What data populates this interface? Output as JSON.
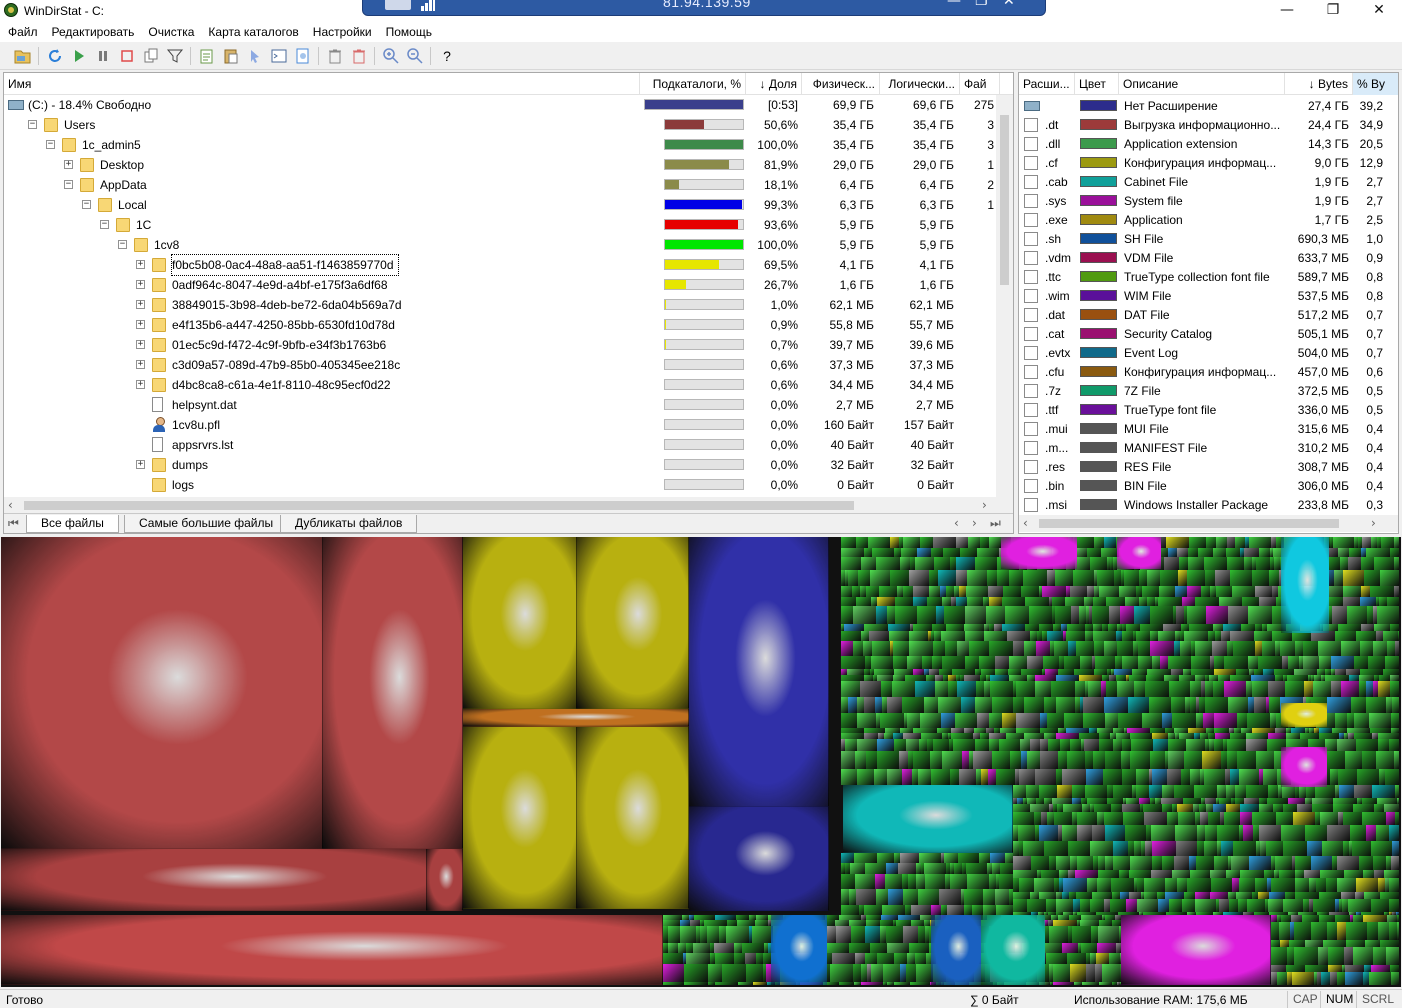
{
  "window": {
    "title": "WinDirStat - C:",
    "remote_ip": "81.94.139.59",
    "min_glyph": "—",
    "max_glyph": "❐",
    "close_glyph": "✕",
    "rdp_min_glyph": "—",
    "rdp_max_glyph": "❐",
    "rdp_close_glyph": "✕"
  },
  "menu": [
    "Файл",
    "Редактировать",
    "Очистка",
    "Карта каталогов",
    "Настройки",
    "Помощь"
  ],
  "toolbar": {
    "icons": [
      "open-icon",
      "refresh-icon",
      "play-icon",
      "pause-icon",
      "stop-icon",
      "copy-path-icon",
      "filter-icon",
      "explorer-icon",
      "paste-icon",
      "select-icon",
      "cmd-icon",
      "properties-icon",
      "delete-recycle-icon",
      "delete-icon",
      "zoom-in-icon",
      "zoom-out-icon",
      "help-icon"
    ],
    "help_label": "?"
  },
  "dir_list": {
    "headers": [
      "Имя",
      "Подкаталоги, %",
      "↓ Доля",
      "Физическ...",
      "Логически...",
      "Фай"
    ],
    "rows": [
      {
        "name": "(C:) - 18.4% Свободно",
        "pct": "[0:53]",
        "phys": "69,9 ГБ",
        "log": "69,6 ГБ",
        "files": "275",
        "bar": 1.0,
        "color": "#3a3f8c",
        "icon": "drive-icon"
      },
      {
        "name": "Users",
        "pct": "50,6%",
        "phys": "35,4 ГБ",
        "log": "35,4 ГБ",
        "files": "3",
        "bar": 0.506,
        "color": "#8b3a3a",
        "icon": "folder-icon"
      },
      {
        "name": "1c_admin5",
        "pct": "100,0%",
        "phys": "35,4 ГБ",
        "log": "35,4 ГБ",
        "files": "3",
        "bar": 1.0,
        "color": "#3d8a4a",
        "icon": "folder-icon"
      },
      {
        "name": "Desktop",
        "pct": "81,9%",
        "phys": "29,0 ГБ",
        "log": "29,0 ГБ",
        "files": "1",
        "bar": 0.819,
        "color": "#8b8b4a",
        "icon": "folder-icon"
      },
      {
        "name": "AppData",
        "pct": "18,1%",
        "phys": "6,4 ГБ",
        "log": "6,4 ГБ",
        "files": "2",
        "bar": 0.181,
        "color": "#8b8b4a",
        "icon": "folder-icon"
      },
      {
        "name": "Local",
        "pct": "99,3%",
        "phys": "6,3 ГБ",
        "log": "6,3 ГБ",
        "files": "1",
        "bar": 0.993,
        "color": "#0000e6",
        "icon": "folder-icon"
      },
      {
        "name": "1C",
        "pct": "93,6%",
        "phys": "5,9 ГБ",
        "log": "5,9 ГБ",
        "files": "",
        "bar": 0.936,
        "color": "#e60000",
        "icon": "folder-icon"
      },
      {
        "name": "1cv8",
        "pct": "100,0%",
        "phys": "5,9 ГБ",
        "log": "5,9 ГБ",
        "files": "",
        "bar": 1.0,
        "color": "#00e600",
        "icon": "folder-icon"
      },
      {
        "name": "f0bc5b08-0ac4-48a8-aa51-f1463859770d",
        "pct": "69,5%",
        "phys": "4,1 ГБ",
        "log": "4,1 ГБ",
        "files": "",
        "bar": 0.695,
        "color": "#e6e600",
        "icon": "folder-icon"
      },
      {
        "name": "0adf964c-8047-4e9d-a4bf-e175f3a6df68",
        "pct": "26,7%",
        "phys": "1,6 ГБ",
        "log": "1,6 ГБ",
        "files": "",
        "bar": 0.267,
        "color": "#e6e600",
        "icon": "folder-icon"
      },
      {
        "name": "38849015-3b98-4deb-be72-6da04b569a7d",
        "pct": "1,0%",
        "phys": "62,1 МБ",
        "log": "62,1 МБ",
        "files": "",
        "bar": 0.01,
        "color": "#e6e600",
        "icon": "folder-icon"
      },
      {
        "name": "e4f135b6-a447-4250-85bb-6530fd10d78d",
        "pct": "0,9%",
        "phys": "55,8 МБ",
        "log": "55,7 МБ",
        "files": "",
        "bar": 0.009,
        "color": "#e6e600",
        "icon": "folder-icon"
      },
      {
        "name": "01ec5c9d-f472-4c9f-9bfb-e34f3b1763b6",
        "pct": "0,7%",
        "phys": "39,7 МБ",
        "log": "39,6 МБ",
        "files": "",
        "bar": 0.007,
        "color": "#e6e600",
        "icon": "folder-icon"
      },
      {
        "name": "c3d09a57-089d-47b9-85b0-405345ee218c",
        "pct": "0,6%",
        "phys": "37,3 МБ",
        "log": "37,3 МБ",
        "files": "",
        "bar": 0.006,
        "color": "#e6e600",
        "icon": "folder-icon"
      },
      {
        "name": "d4bc8ca8-c61a-4e1f-8110-48c95ecf0d22",
        "pct": "0,6%",
        "phys": "34,4 МБ",
        "log": "34,4 МБ",
        "files": "",
        "bar": 0.006,
        "color": "#e6e600",
        "icon": "folder-icon"
      },
      {
        "name": "helpsynt.dat",
        "pct": "0,0%",
        "phys": "2,7 МБ",
        "log": "2,7 МБ",
        "files": "",
        "bar": 0.0,
        "color": "#e6e600",
        "icon": "file-icon"
      },
      {
        "name": "1cv8u.pfl",
        "pct": "0,0%",
        "phys": "160 Байт",
        "log": "157 Байт",
        "files": "",
        "bar": 0.0,
        "color": "#e6e600",
        "icon": "user-icon"
      },
      {
        "name": "appsrvrs.lst",
        "pct": "0,0%",
        "phys": "40 Байт",
        "log": "40 Байт",
        "files": "",
        "bar": 0.0,
        "color": "#e6e600",
        "icon": "file-icon"
      },
      {
        "name": "dumps",
        "pct": "0,0%",
        "phys": "32 Байт",
        "log": "32 Байт",
        "files": "",
        "bar": 0.0,
        "color": "#e6e600",
        "icon": "folder-icon"
      },
      {
        "name": "logs",
        "pct": "0,0%",
        "phys": "0 Байт",
        "log": "0 Байт",
        "files": "",
        "bar": 0.0,
        "color": "#e6e600",
        "icon": "folder-icon"
      }
    ],
    "tabs": [
      "Все файлы",
      "Самые большие файлы",
      "Дубликаты файлов"
    ]
  },
  "ext_list": {
    "headers": [
      "Расши...",
      "Цвет",
      "Описание",
      "↓ Bytes",
      "% By"
    ],
    "rows": [
      {
        "ext": "",
        "color": "#2c2c8c",
        "desc": "Нет Расширение",
        "bytes": "27,4 ГБ",
        "pct": "39,2",
        "icon": "drive-icon"
      },
      {
        "ext": ".dt",
        "color": "#9c3a3a",
        "desc": "Выгрузка информационно...",
        "bytes": "24,4 ГБ",
        "pct": "34,9",
        "icon": "dt-file-icon"
      },
      {
        "ext": ".dll",
        "color": "#3c9a4c",
        "desc": "Application extension",
        "bytes": "14,3 ГБ",
        "pct": "20,5",
        "icon": "dll-file-icon"
      },
      {
        "ext": ".cf",
        "color": "#9c9a10",
        "desc": "Конфигурация информац...",
        "bytes": "9,0 ГБ",
        "pct": "12,9",
        "icon": "cf-file-icon"
      },
      {
        "ext": ".cab",
        "color": "#10a09a",
        "desc": "Cabinet File",
        "bytes": "1,9 ГБ",
        "pct": "2,7",
        "icon": "cab-file-icon"
      },
      {
        "ext": ".sys",
        "color": "#9a109a",
        "desc": "System file",
        "bytes": "1,9 ГБ",
        "pct": "2,7",
        "icon": "sys-file-icon"
      },
      {
        "ext": ".exe",
        "color": "#a08a10",
        "desc": "Application",
        "bytes": "1,7 ГБ",
        "pct": "2,5",
        "icon": "exe-file-icon"
      },
      {
        "ext": ".sh",
        "color": "#10509a",
        "desc": "SH File",
        "bytes": "690,3 МБ",
        "pct": "1,0",
        "icon": "sh-file-icon"
      },
      {
        "ext": ".vdm",
        "color": "#9a1050",
        "desc": "VDM File",
        "bytes": "633,7 МБ",
        "pct": "0,9",
        "icon": "vdm-file-icon"
      },
      {
        "ext": ".ttc",
        "color": "#509a10",
        "desc": "TrueType collection font file",
        "bytes": "589,7 МБ",
        "pct": "0,8",
        "icon": "ttc-file-icon"
      },
      {
        "ext": ".wim",
        "color": "#5a109a",
        "desc": "WIM File",
        "bytes": "537,5 МБ",
        "pct": "0,8",
        "icon": "wim-file-icon"
      },
      {
        "ext": ".dat",
        "color": "#9a5010",
        "desc": "DAT File",
        "bytes": "517,2 МБ",
        "pct": "0,7",
        "icon": "dat-file-icon"
      },
      {
        "ext": ".cat",
        "color": "#9a1070",
        "desc": "Security Catalog",
        "bytes": "505,1 МБ",
        "pct": "0,7",
        "icon": "cat-file-icon"
      },
      {
        "ext": ".evtx",
        "color": "#106a8a",
        "desc": "Event Log",
        "bytes": "504,0 МБ",
        "pct": "0,7",
        "icon": "evtx-file-icon"
      },
      {
        "ext": ".cfu",
        "color": "#8a5a10",
        "desc": "Конфигурация информац...",
        "bytes": "457,0 МБ",
        "pct": "0,6",
        "icon": "cfu-file-icon"
      },
      {
        "ext": ".7z",
        "color": "#109a6a",
        "desc": "7Z File",
        "bytes": "372,5 МБ",
        "pct": "0,5",
        "icon": "7z-file-icon"
      },
      {
        "ext": ".ttf",
        "color": "#6a109a",
        "desc": "TrueType font file",
        "bytes": "336,0 МБ",
        "pct": "0,5",
        "icon": "ttf-file-icon"
      },
      {
        "ext": ".mui",
        "color": "#555555",
        "desc": "MUI File",
        "bytes": "315,6 МБ",
        "pct": "0,4",
        "icon": "mui-file-icon"
      },
      {
        "ext": ".m...",
        "color": "#555555",
        "desc": "MANIFEST File",
        "bytes": "310,2 МБ",
        "pct": "0,4",
        "icon": "manifest-file-icon"
      },
      {
        "ext": ".res",
        "color": "#555555",
        "desc": "RES File",
        "bytes": "308,7 МБ",
        "pct": "0,4",
        "icon": "res-file-icon"
      },
      {
        "ext": ".bin",
        "color": "#555555",
        "desc": "BIN File",
        "bytes": "306,0 МБ",
        "pct": "0,4",
        "icon": "bin-file-icon"
      },
      {
        "ext": ".msi",
        "color": "#555555",
        "desc": "Windows Installer Package",
        "bytes": "233,8 МБ",
        "pct": "0,3",
        "icon": "msi-file-icon"
      }
    ]
  },
  "status": {
    "ready": "Готово",
    "sum": "∑ 0 Байт",
    "ram": "Использование RAM: 175,6 МБ",
    "cap": "CAP",
    "num": "NUM",
    "scrl": "SCRL"
  },
  "colors": {
    "selection_outline": "#000000",
    "header_sel": "#d9ebf9",
    "rdp_bar": "#2d5aa3"
  }
}
